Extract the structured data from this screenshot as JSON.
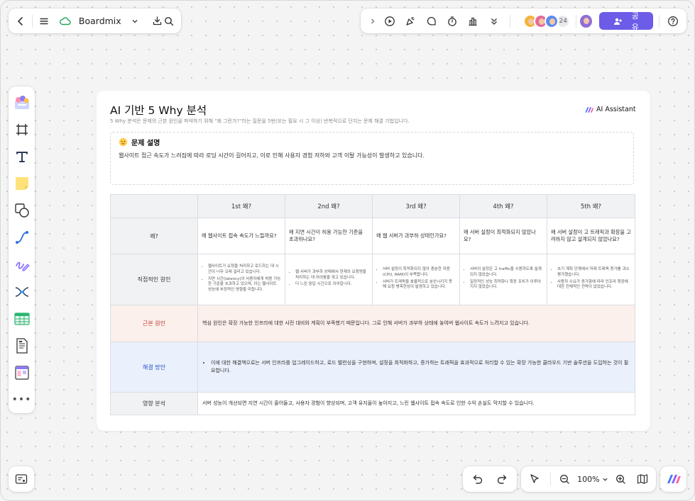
{
  "topbar": {
    "brand": "Boardmix"
  },
  "collaborators": {
    "count": "24"
  },
  "share": {
    "label": "공유"
  },
  "zoom": {
    "level": "100%"
  },
  "document": {
    "title": "AI 기반 5 Why 분석",
    "subtitle": "5 Why 분석은 문제의 근본 원인을 파악하기 위해 \"왜 그런가?\"라는 질문을 5번(또는 필요 시 그 이상) 반복적으로 던지는 문제 해결 기법입니다.",
    "ai_badge": "AI Assistant",
    "problem": {
      "heading": "문제 설명",
      "text": "웹사이트 접근 속도가 느려짐에 따라 로딩 시간이 길어지고, 이로 인해 사용자 경험 저하와 고객 이탈 가능성이 발생하고 있습니다."
    }
  },
  "table": {
    "headers": [
      "",
      "1st 왜?",
      "2nd 왜?",
      "3rd 왜?",
      "4th 왜?",
      "5th 왜?"
    ],
    "why_row": {
      "label": "왜?",
      "cells": [
        "왜 웹사이트 접속 속도가 느릴까요?",
        "왜 지연 시간이 허용 가능한 기준을 초과하나요?",
        "왜 웹 서버가 과부하 상태인가요?",
        "왜 서버 설정이 최적화되지 않았나요?",
        "왜 서버 설정이 고 트래픽과 확장을 고려하지 않고 설계되지 않았나요?"
      ]
    },
    "direct_row": {
      "label": "직접적인 원인",
      "cells": [
        [
          "웹사이트가 요청을 처리하고 로드하는 데 시간이 너무 오래 걸리고 있습니다.",
          "지연 시간(latency)이 사용자에게 허용 가능한 기준을 초과하고 있으며, 이는 웹사이트 성능에 부정적인 영향을 미칩니다."
        ],
        [
          "웹 서버가 과부하 상태에서 현재의 요청량을 처리하는 데 어려움을 겪고 있습니다.",
          "더 느린 응답 시간으로 이어집니다."
        ],
        [
          "서버 설정이 최적화되지 않아 충분한 자원(CPU, RAM)이 부족합니다.",
          "서버가 트래픽을 효율적으로 분산시키지 못해 요청 병목현상이 발생하고 있습니다."
        ],
        [
          "서버의 설정은 고 traffic을 수용하도록 설계되지 않았습니다.",
          "일정적인 성능 최적화나 확장 조치가 이루어지지 않았습니다."
        ],
        [
          "초기 계획 단계에서 미래 트래픽 증가를 과소평가했습니다.",
          "사용자 수요가 증가함에 따라 인프라 확장에 대한 전체적인 전략이 없었습니다."
        ]
      ]
    },
    "root_row": {
      "label": "근본 원인",
      "text": "핵심 원인은 확장 가능한 인프라에 대한 사전 대비와 계획이 부족했기 때문입니다. 그로 인해 서버가 과부하 상태에 놓여버 웹사이트 속도가 느려지고 있습니다."
    },
    "solution_row": {
      "label": "해결 방안",
      "text": "이에 대한 해결책으로는 서버 인프라를 업그레이드하고, 로드 밸런싱을 구현하며, 설정을 최적화하고, 증가하는 트래픽을 효과적으로 처리할 수 있는 확장 가능한 클라우드 기반 솔루션을 도입하는 것이 필요합니다."
    },
    "impact_row": {
      "label": "영향 분석",
      "text": "서버 성능이 개선되면 지연 시간이 줄어들고, 사용자 경험이 향상되며, 고객 유지율이 높아지고, 느린 웹사이트 접속 속도로 인한 수익 손실도 막지할 수 있습니다."
    }
  }
}
